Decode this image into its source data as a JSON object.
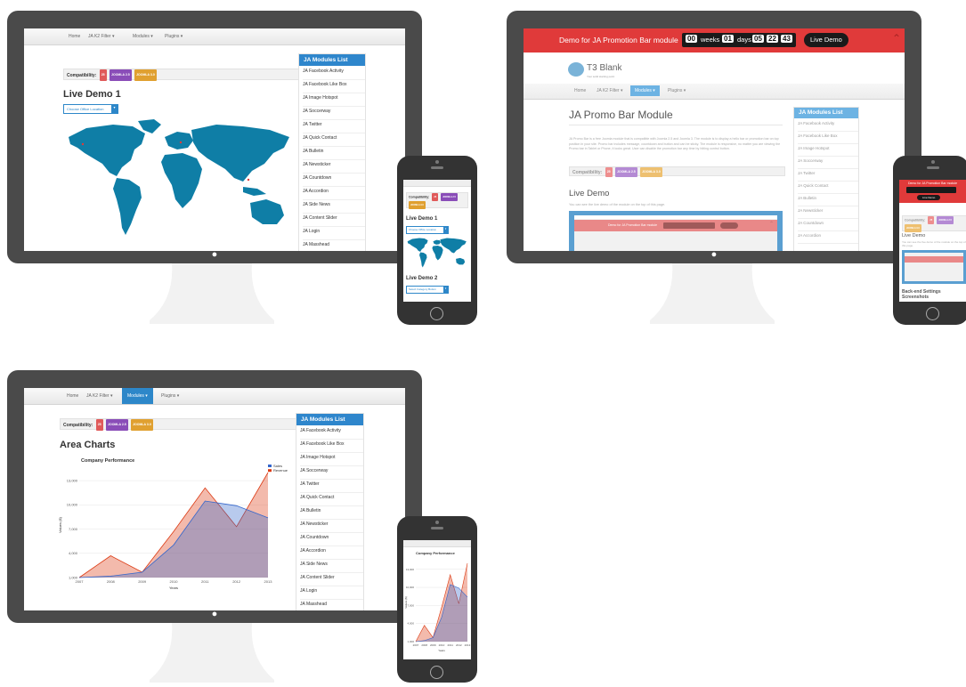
{
  "nav": {
    "home": "Home",
    "k2_filter": "JA K2 Filter ▾",
    "modules": "Modules ▾",
    "plugins": "Plugins ▾"
  },
  "compat": {
    "label": "Compatibility:",
    "badge1": "25",
    "badge2": "JOOMLA 2.5",
    "badge3": "JOOMLA 3.0"
  },
  "sidebar": {
    "title": "JA Modules List",
    "items": [
      "JA Facebook Activity",
      "JA Facebook Like Box",
      "JA Image Hotspot",
      "JA Soccerway",
      "JA Twitter",
      "JA Quick Contact",
      "JA Bulletin",
      "JA Newsticker",
      "JA Countdown",
      "JA Accordion",
      "JA Side News",
      "JA Content Slider",
      "JA Login",
      "JA Masshead"
    ],
    "items_short": [
      "JA Facebook Activity",
      "JA Facebook Like Box",
      "JA Image Hotspot",
      "JA Soccerway",
      "JA Twitter",
      "JA Quick Contact",
      "JA Bulletin",
      "JA Newsticker",
      "JA Countdown",
      "JA Accordion"
    ]
  },
  "demo1": {
    "title": "Live Demo 1",
    "button": "Choose Office Location",
    "phone_title2": "Live Demo 2",
    "phone_button2": "Select Category Button"
  },
  "promo": {
    "bar_text": "Demo for JA Promotion Bar module",
    "weeks_num": "00",
    "weeks_label": "weeks",
    "days_num": "01",
    "days_label": "days",
    "h": "05",
    "m": "22",
    "s": "43",
    "live_button": "Live Demo",
    "logo_name": "T3 Blank",
    "logo_tagline": "Your solid starting point",
    "title": "JA Promo Bar Module",
    "description": "JA Promo Bar is a free Joomla module that is compatible with Joomla 2.5 and Joomla 3. The module is to display a hello bar or promotion bar on top position in your site. Promo bar includes message, countdown and button and can be sticky. The module is responsive, no matter you are viewing the Promo bar in Tablet or Phone, it looks great. User can disable the promotion bar any time by hitting control button.",
    "live_title": "Live Demo",
    "live_desc": "You can see the live demo of the module on the top of this page.",
    "phone_live_title": "Live Demo",
    "phone_live_desc": "You can see the live demo of the module on the top of this page.",
    "phone_bottom": "Back-end Settings Screenshots"
  },
  "area": {
    "title": "Area Charts",
    "chart_title": "Company Performance",
    "xlabel": "Years",
    "ylabel": "Values ($)"
  },
  "chart_data": {
    "type": "area",
    "title": "Company Performance",
    "xlabel": "Years",
    "ylabel": "Values ($)",
    "categories": [
      "2007",
      "2008",
      "2009",
      "2010",
      "2011",
      "2012",
      "2013"
    ],
    "series": [
      {
        "name": "Sales",
        "values": [
          1000,
          1170,
          1660,
          5030,
          10470,
          9890,
          8400
        ]
      },
      {
        "name": "Revenue",
        "values": [
          1000,
          3700,
          1660,
          6700,
          12100,
          7300,
          14000
        ]
      }
    ],
    "yticks": [
      "1,000",
      "4,000",
      "7,000",
      "10,000",
      "13,000"
    ],
    "ylim": [
      1000,
      14000
    ],
    "legend": "top-right",
    "colors": {
      "Sales": "#3366cc",
      "Revenue": "#dc3912"
    }
  },
  "colors": {
    "accent": "#2e86cc",
    "promo_red": "#e03a3a",
    "map_teal": "#0f7ea6",
    "badge_red": "#e05a5a",
    "badge_purple": "#8a4db8",
    "badge_orange": "#e0a030"
  },
  "icons": {
    "apple": "apple-logo-icon",
    "caret": "chevron-down-icon",
    "collapse": "chevron-up-icon"
  }
}
